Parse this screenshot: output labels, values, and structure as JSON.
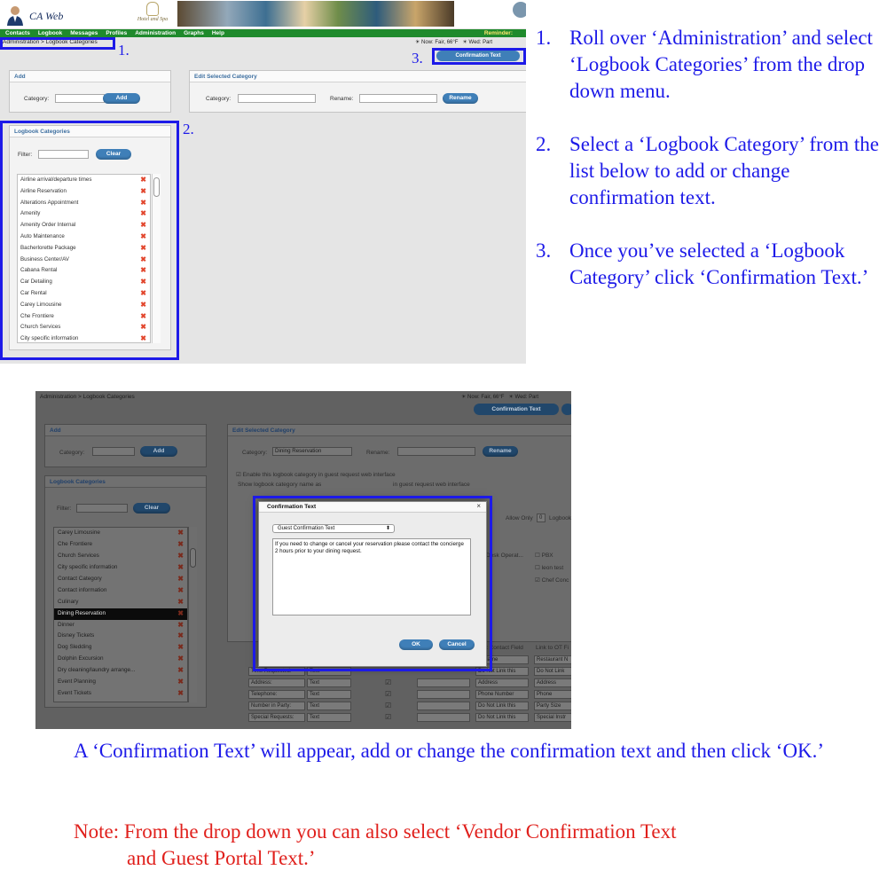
{
  "shot1": {
    "brand": "CA Web",
    "hotel_name": "Hotel and Spa",
    "nav": [
      "Contacts",
      "Logbook",
      "Messages",
      "Profiles",
      "Administration",
      "Graphs",
      "Help"
    ],
    "nav_right": "Reminder:",
    "breadcrumb": "Administration > Logbook Categories",
    "weather": "Now: Fair, 66°F",
    "weather_next": "Wed: Part",
    "confirmation_button": "Confirmation Text",
    "add_panel": {
      "title": "Add",
      "category_label": "Category:",
      "add_button": "Add"
    },
    "edit_panel": {
      "title": "Edit Selected Category",
      "category_label": "Category:",
      "rename_label": "Rename:",
      "rename_button": "Rename"
    },
    "list_panel": {
      "title": "Logbook Categories",
      "filter_label": "Filter:",
      "clear_button": "Clear"
    },
    "categories": [
      "Airline arrival/departure times",
      "Airline Reservation",
      "Alterations Appointment",
      "Amenity",
      "Amenity Order Internal",
      "Auto Maintenance",
      "Bacherlorette Package",
      "Business Center/AV",
      "Cabana Rental",
      "Car Detailing",
      "Car Rental",
      "Carey Limousine",
      "Che Frontiere",
      "Church Services",
      "City specific information"
    ],
    "markers": [
      "1.",
      "2.",
      "3."
    ]
  },
  "instructions": [
    {
      "num": "1.",
      "text": "Roll over ‘Administration’ and select ‘Logbook Categories’ from the drop down menu."
    },
    {
      "num": "2.",
      "text": "Select a ‘Logbook Category’ from the list below to add or change confirmation text."
    },
    {
      "num": "3.",
      "text": "Once you’ve selected a ‘Logbook Category’  click ‘Confirmation Text.’"
    }
  ],
  "shot2": {
    "breadcrumb": "Administration > Logbook Categories",
    "weather": "Now: Fair, 66°F",
    "weather_next": "Wed: Part",
    "confirmation_button": "Confirmation Text",
    "add_panel": {
      "title": "Add",
      "category_label": "Category:",
      "add_button": "Add"
    },
    "edit_panel": {
      "title": "Edit Selected Category",
      "category_label": "Category:",
      "category_value": "Dining Reservation",
      "rename_label": "Rename:",
      "rename_button": "Rename"
    },
    "enable_text": "Enable this logbook category in guest request web interface",
    "show_name_text": "Show logbook category name as",
    "show_name_suffix": "in guest request web interface",
    "allow_only": "Allow Only",
    "allow_only_value": "0",
    "logbook_text": "Logbook",
    "checkbox_labels": [
      "PBX",
      "leon test",
      "Chef Conc"
    ],
    "desk_operator": "Desk Operat...",
    "list_panel": {
      "title": "Logbook Categories",
      "filter_label": "Filter:",
      "clear_button": "Clear"
    },
    "categories": [
      "Carey Limousine",
      "Che Frontiere",
      "Church Services",
      "City specific information",
      "Contact Category",
      "Contact information",
      "Culinary",
      "Dining Reservation",
      "Dinner",
      "Disney Tickets",
      "Dog Sledding",
      "Dolphin Excursion",
      "Dry cleaning/laundry arrange...",
      "Event Planning",
      "Event Tickets"
    ],
    "selected_category": "Dining Reservation",
    "table_header": {
      "contact_field": "t Contact Field",
      "link_ot": "Link to OT Fi"
    },
    "table_rows": [
      {
        "label": "Time Requested:",
        "type": "Text",
        "contact": "Do Not Link this",
        "ot": "Do Not Link"
      },
      {
        "label": "Address:",
        "type": "Text",
        "contact": "Address",
        "ot": "Address"
      },
      {
        "label": "Telephone:",
        "type": "Text",
        "contact": "Phone Number",
        "ot": "Phone"
      },
      {
        "label": "Number in Party:",
        "type": "Text",
        "contact": "Do Not Link this",
        "ot": "Party Size"
      },
      {
        "label": "Special Requests:",
        "type": "Text",
        "contact": "Do Not Link this",
        "ot": "Special Instr"
      }
    ],
    "first_row_contact": "ct Name",
    "first_row_ot": "Restaurant N",
    "modal": {
      "title": "Confirmation Text",
      "close": "×",
      "select_value": "Guest Confirmation Text",
      "text": "If you need to change or cancel your reservation please contact the concierge 2 hours prior to your dining request.",
      "ok": "OK",
      "cancel": "Cancel"
    }
  },
  "caption": "A ‘Confirmation Text’ will appear, add or change the confirmation text and then click ‘OK.’",
  "note_line1": "Note: From the drop down you can also select ‘Vendor Confirmation Text",
  "note_line2": "and Guest Portal Text.’",
  "colors": {
    "instruction_blue": "#1d1ae8",
    "note_red": "#e0201c",
    "nav_green": "#1f8a2c",
    "button_blue": "#3f7fb8"
  }
}
